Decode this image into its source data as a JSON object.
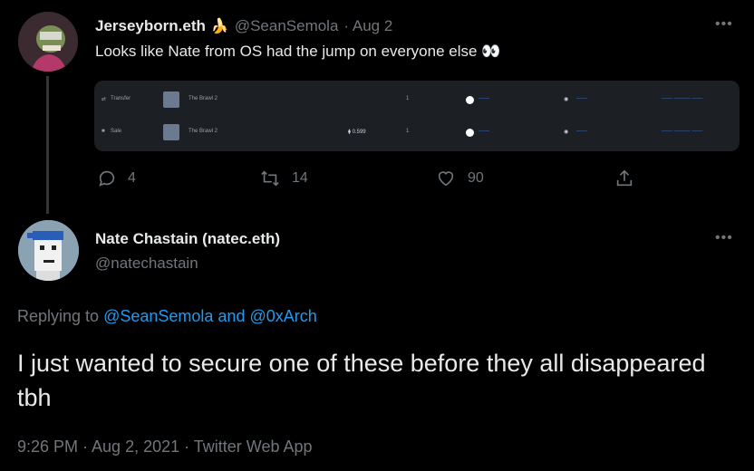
{
  "tweet1": {
    "display_name": "Jerseyborn.eth",
    "name_emoji": "🍌",
    "handle": "@SeanSemola",
    "date": "· Aug 2",
    "text": "Looks like Nate from OS had the jump on everyone else 👀",
    "embed": {
      "rows": [
        {
          "event": "Transfer",
          "item": "The Brawl 2",
          "price": "",
          "qty": "1",
          "from": "——",
          "to": "——",
          "time": "—— ——— ——"
        },
        {
          "event": "Sale",
          "item": "The Brawl 2",
          "price": "⧫ 0.599",
          "qty": "1",
          "from": "——",
          "to": "——",
          "time": "—— ——— ——"
        }
      ]
    },
    "actions": {
      "replies": "4",
      "retweets": "14",
      "likes": "90"
    }
  },
  "tweet2": {
    "display_name": "Nate Chastain (natec.eth)",
    "handle": "@natechastain",
    "replying_prefix": "Replying to",
    "replying_targets": "@SeanSemola and @0xArch",
    "text": "I just wanted to secure one of these before they all disappeared tbh",
    "meta": "9:26 PM · Aug 2, 2021 · Twitter Web App"
  },
  "more_glyph": "•••"
}
